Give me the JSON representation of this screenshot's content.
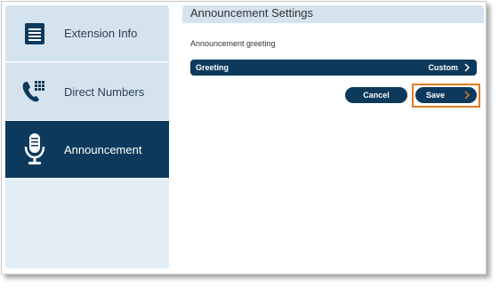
{
  "sidebar": {
    "items": [
      {
        "label": "Extension Info",
        "icon": "document-list-icon",
        "active": false
      },
      {
        "label": "Direct Numbers",
        "icon": "phone-keypad-icon",
        "active": false
      },
      {
        "label": "Announcement",
        "icon": "microphone-icon",
        "active": true
      }
    ]
  },
  "panel": {
    "title": "Announcement Settings",
    "greeting_section_label": "Announcement greeting",
    "greeting_row": {
      "label": "Greeting",
      "value": "Custom"
    },
    "cancel_label": "Cancel",
    "save_label": "Save"
  },
  "colors": {
    "accent": "#0d3a5c",
    "sidebar_bg": "#d5e3ef",
    "highlight": "#e07b21"
  }
}
